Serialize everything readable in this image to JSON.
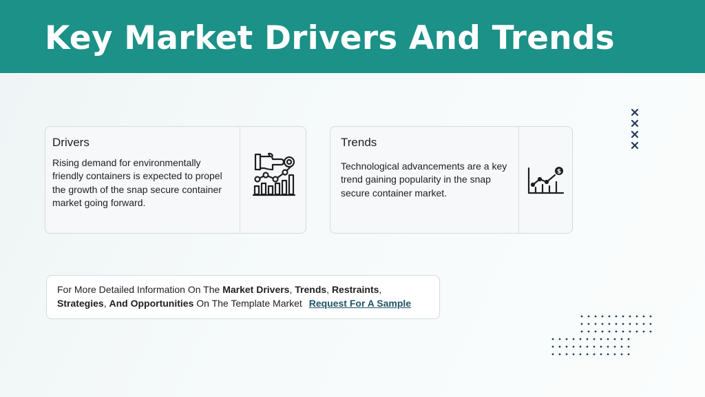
{
  "header": {
    "title": "Key Market Drivers And Trends",
    "background": "#1b9187"
  },
  "drivers": {
    "heading": "Drivers",
    "body": "Rising demand for environmentally friendly containers is expected to propel the growth of the snap secure container market going forward.",
    "icon": "hand-chart-icon"
  },
  "trends": {
    "heading": "Trends",
    "body": "Technological advancements are a key trend gaining popularity in the snap secure container market.",
    "icon": "growth-chart-icon"
  },
  "cta": {
    "l1_prefix": "For More Detailed Information On The ",
    "l1_b1": "Market Drivers",
    "l1_sep1": ", ",
    "l1_b2": "Trends",
    "l1_sep2": ", ",
    "l1_b3": "Restraints",
    "l1_sep3": ",",
    "l2_b1": "Strategies",
    "l2_sep1": ", ",
    "l2_b2": "And Opportunities",
    "l2_mid": " On The Template Market ",
    "link": "Request For A Sample",
    "link_color": "#1f5364"
  },
  "decor": {
    "x_marks": "cross-marks-icon",
    "dots": "dot-grid-icon",
    "accent": "#233a5e"
  }
}
